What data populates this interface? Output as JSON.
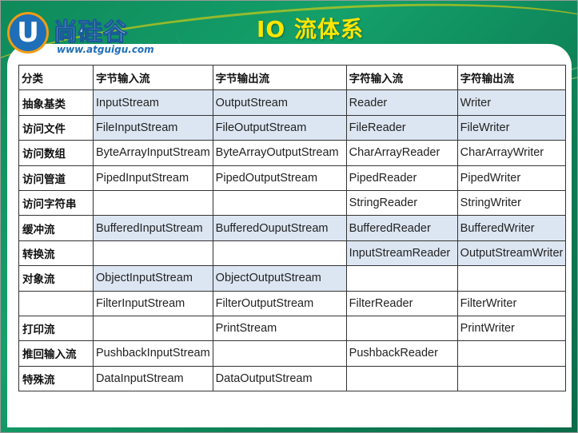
{
  "title": "IO 流体系",
  "logo": {
    "mark": "U",
    "name": "尚硅谷",
    "url": "www.atguigu.com"
  },
  "table": {
    "headers": [
      "分类",
      "字节输入流",
      "字节输出流",
      "字符输入流",
      "字符输出流"
    ],
    "rows": [
      {
        "category": "抽象基类",
        "cells": [
          "InputStream",
          "OutputStream",
          "Reader",
          "Writer"
        ],
        "highlight": [
          true,
          true,
          true,
          true
        ]
      },
      {
        "category": "访问文件",
        "cells": [
          "FileInputStream",
          "FileOutputStream",
          "FileReader",
          "FileWriter"
        ],
        "highlight": [
          true,
          true,
          true,
          true
        ]
      },
      {
        "category": "访问数组",
        "cells": [
          "ByteArrayInputStream",
          "ByteArrayOutputStream",
          "CharArrayReader",
          "CharArrayWriter"
        ],
        "highlight": [
          false,
          false,
          false,
          false
        ]
      },
      {
        "category": "访问管道",
        "cells": [
          "PipedInputStream",
          "PipedOutputStream",
          "PipedReader",
          "PipedWriter"
        ],
        "highlight": [
          false,
          false,
          false,
          false
        ]
      },
      {
        "category": "访问字符串",
        "cells": [
          "",
          "",
          "StringReader",
          "StringWriter"
        ],
        "highlight": [
          false,
          false,
          false,
          false
        ]
      },
      {
        "category": "缓冲流",
        "cells": [
          "BufferedInputStream",
          "BufferedOuputStream",
          "BufferedReader",
          "BufferedWriter"
        ],
        "highlight": [
          true,
          true,
          true,
          true
        ]
      },
      {
        "category": "转换流",
        "cells": [
          "",
          "",
          "InputStreamReader",
          "OutputStreamWriter"
        ],
        "highlight": [
          false,
          false,
          true,
          true
        ]
      },
      {
        "category": "对象流",
        "cells": [
          "ObjectInputStream",
          "ObjectOutputStream",
          "",
          ""
        ],
        "highlight": [
          true,
          true,
          false,
          false
        ]
      },
      {
        "category": "",
        "cells": [
          "FilterInputStream",
          "FilterOutputStream",
          "FilterReader",
          "FilterWriter"
        ],
        "highlight": [
          false,
          false,
          false,
          false
        ]
      },
      {
        "category": "打印流",
        "cells": [
          "",
          "PrintStream",
          "",
          "PrintWriter"
        ],
        "highlight": [
          false,
          false,
          false,
          false
        ]
      },
      {
        "category": "推回输入流",
        "cells": [
          "PushbackInputStream",
          "",
          "PushbackReader",
          ""
        ],
        "highlight": [
          false,
          false,
          false,
          false
        ]
      },
      {
        "category": "特殊流",
        "cells": [
          "DataInputStream",
          "DataOutputStream",
          "",
          ""
        ],
        "highlight": [
          false,
          false,
          false,
          false
        ]
      }
    ]
  },
  "colors": {
    "background_green": "#14a06a",
    "title_yellow": "#ffe600",
    "highlight_cell": "#dce6f2",
    "logo_blue": "#1f6fb8",
    "logo_orange": "#f39c12"
  }
}
